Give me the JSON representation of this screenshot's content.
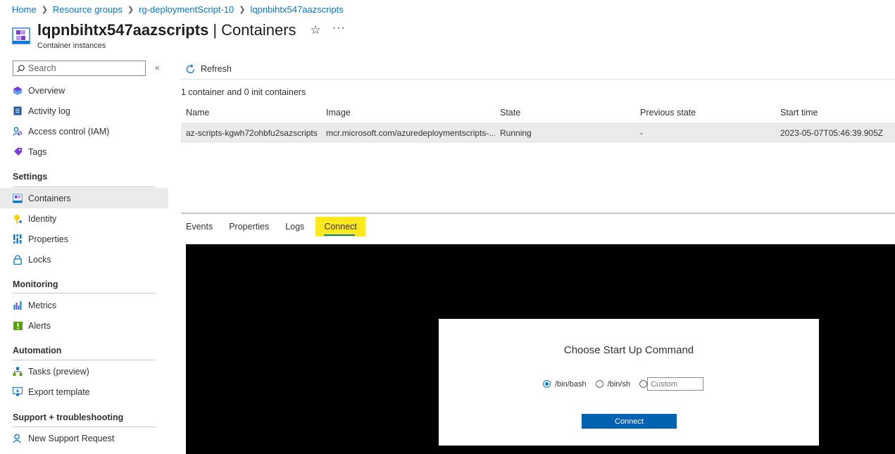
{
  "breadcrumb": {
    "items": [
      "Home",
      "Resource groups",
      "rg-deploymentScript-10",
      "lqpnbihtx547aazscripts"
    ]
  },
  "header": {
    "resource_name": "lqpnbihtx547aazscripts",
    "page_name": "| Containers",
    "subtitle": "Container instances",
    "favorite_icon": "star-icon",
    "more_icon": "more-icon"
  },
  "sidebar": {
    "search_placeholder": "Search",
    "top_items": [
      {
        "label": "Overview",
        "icon": "overview-icon"
      },
      {
        "label": "Activity log",
        "icon": "activity-log-icon"
      },
      {
        "label": "Access control (IAM)",
        "icon": "iam-icon"
      },
      {
        "label": "Tags",
        "icon": "tag-icon"
      }
    ],
    "sections": [
      {
        "title": "Settings",
        "items": [
          {
            "label": "Containers",
            "icon": "containers-icon",
            "active": true
          },
          {
            "label": "Identity",
            "icon": "identity-icon"
          },
          {
            "label": "Properties",
            "icon": "properties-icon"
          },
          {
            "label": "Locks",
            "icon": "lock-icon"
          }
        ]
      },
      {
        "title": "Monitoring",
        "items": [
          {
            "label": "Metrics",
            "icon": "metrics-icon"
          },
          {
            "label": "Alerts",
            "icon": "alerts-icon"
          }
        ]
      },
      {
        "title": "Automation",
        "items": [
          {
            "label": "Tasks (preview)",
            "icon": "tasks-icon"
          },
          {
            "label": "Export template",
            "icon": "export-template-icon"
          }
        ]
      },
      {
        "title": "Support + troubleshooting",
        "items": [
          {
            "label": "New Support Request",
            "icon": "support-icon"
          }
        ]
      }
    ]
  },
  "toolbar": {
    "refresh_label": "Refresh"
  },
  "main": {
    "count_text": "1 container and 0 init containers",
    "columns": [
      "Name",
      "Image",
      "State",
      "Previous state",
      "Start time"
    ],
    "rows": [
      [
        "az-scripts-kgwh72ohbfu2sazscripts",
        "mcr.microsoft.com/azuredeploymentscripts-...",
        "Running",
        "-",
        "2023-05-07T05:46:39.905Z"
      ]
    ],
    "tabs": [
      "Events",
      "Properties",
      "Logs",
      "Connect"
    ],
    "active_tab": "Connect"
  },
  "connect_dialog": {
    "title": "Choose Start Up Command",
    "options": [
      "/bin/bash",
      "/bin/sh"
    ],
    "selected": "/bin/bash",
    "custom_placeholder": "Custom",
    "connect_label": "Connect"
  },
  "colors": {
    "accent": "#0078d4",
    "highlight": "#ffe81b",
    "button": "#0062b1"
  }
}
